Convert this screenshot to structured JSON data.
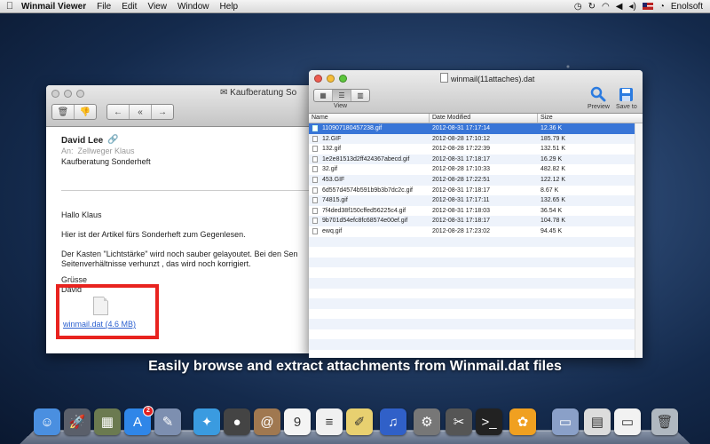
{
  "menubar": {
    "app_name": "Winmail Viewer",
    "menus": [
      "File",
      "Edit",
      "View",
      "Window",
      "Help"
    ],
    "user": "Enolsoft",
    "status_icons": [
      "time-machine-icon",
      "sync-icon",
      "wifi-icon",
      "back-icon",
      "volume-icon",
      "us-flag-icon",
      "clock-icon"
    ]
  },
  "mail": {
    "window_title": "Kaufberatung So",
    "from": "David Lee",
    "to_label": "An:",
    "to": "Zellweger Klaus",
    "subject": "Kaufberatung Sonderheft",
    "greeting": "Hallo Klaus",
    "line1": "Hier ist der Artikel fürs Sonderheft zum Gegenlesen.",
    "line2": "Der Kasten \"Lichtstärke\" wird noch sauber gelayoutet. Bei den Sen",
    "line3": "Seitenverhältnisse verhunzt , das wird noch korrigiert.",
    "closing": "Grüsse",
    "signature": "David",
    "attachment": "winmail.dat (4.6 MB)"
  },
  "viewer": {
    "window_title": "winmail(11attaches).dat",
    "view_label": "View",
    "preview_label": "Preview",
    "save_label": "Save to",
    "columns": {
      "name": "Name",
      "date": "Date Modified",
      "size": "Size"
    },
    "files": [
      {
        "name": "110907180457238.gif",
        "date": "2012-08-31 17:17:14",
        "size": "12.36 K"
      },
      {
        "name": "12.GIF",
        "date": "2012-08-28 17:10:12",
        "size": "185.79 K"
      },
      {
        "name": "132.gif",
        "date": "2012-08-28 17:22:39",
        "size": "132.51 K"
      },
      {
        "name": "1e2e81513d2ff424367abecd.gif",
        "date": "2012-08-31 17:18:17",
        "size": "16.29 K"
      },
      {
        "name": "32.gif",
        "date": "2012-08-28 17:10:33",
        "size": "482.82 K"
      },
      {
        "name": "453.GIF",
        "date": "2012-08-28 17:22:51",
        "size": "122.12 K"
      },
      {
        "name": "6d557d4574b591b9b3b7dc2c.gif",
        "date": "2012-08-31 17:18:17",
        "size": "8.67 K"
      },
      {
        "name": "74815.gif",
        "date": "2012-08-31 17:17:11",
        "size": "132.65 K"
      },
      {
        "name": "7f4ded38f150cffed56225c4.gif",
        "date": "2012-08-31 17:18:03",
        "size": "36.54 K"
      },
      {
        "name": "9b701d54efc8fc68574e00ef.gif",
        "date": "2012-08-31 17:18:17",
        "size": "104.78 K"
      },
      {
        "name": "ewq.gif",
        "date": "2012-08-28 17:23:02",
        "size": "94.45 K"
      }
    ]
  },
  "caption": "Easily browse and extract attachments from Winmail.dat files",
  "dock": {
    "items": [
      {
        "name": "finder-icon",
        "color": "#4a8fe0",
        "glyph": "☺"
      },
      {
        "name": "launchpad-icon",
        "color": "#5a5f6a",
        "glyph": "🚀"
      },
      {
        "name": "photo-app-icon",
        "color": "#6b7a50",
        "glyph": "▦"
      },
      {
        "name": "app-store-icon",
        "color": "#2f86e8",
        "glyph": "A",
        "badge": "2"
      },
      {
        "name": "preview-icon",
        "color": "#7d8fb0",
        "glyph": "✎"
      },
      {
        "name": "safari-icon",
        "color": "#3a9be0",
        "glyph": "✦"
      },
      {
        "name": "facetime-icon",
        "color": "#444",
        "glyph": "●"
      },
      {
        "name": "contacts-icon",
        "color": "#a07850",
        "glyph": "@"
      },
      {
        "name": "calendar-icon",
        "color": "#f4f4f4",
        "glyph": "9"
      },
      {
        "name": "reminders-icon",
        "color": "#f0f0f0",
        "glyph": "≡"
      },
      {
        "name": "notes-icon",
        "color": "#e8d070",
        "glyph": "✐"
      },
      {
        "name": "itunes-icon",
        "color": "#3060c8",
        "glyph": "♫"
      },
      {
        "name": "system-preferences-icon",
        "color": "#777",
        "glyph": "⚙"
      },
      {
        "name": "utility-icon",
        "color": "#555",
        "glyph": "✂"
      },
      {
        "name": "terminal-icon",
        "color": "#222",
        "glyph": ">_"
      },
      {
        "name": "winmail-viewer-icon",
        "color": "#f0a020",
        "glyph": "✿"
      },
      {
        "name": "applications-folder-icon",
        "color": "#8aa0c8",
        "glyph": "▭"
      },
      {
        "name": "document-stack-icon",
        "color": "#dcdcdc",
        "glyph": "▤"
      },
      {
        "name": "document-icon",
        "color": "#f2f2f2",
        "glyph": "▭"
      },
      {
        "name": "trash-icon",
        "color": "#b0b8c0",
        "glyph": "🗑"
      }
    ]
  }
}
